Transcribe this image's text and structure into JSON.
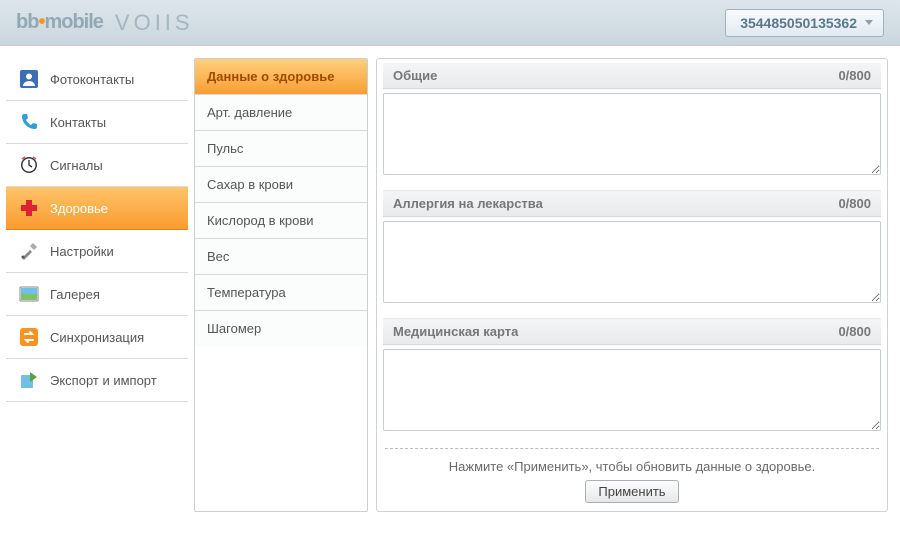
{
  "header": {
    "brand_bb_prefix": "bb",
    "brand_bb_suffix": "mobile",
    "brand_voiis": "VOIIS",
    "device_id": "354485050135362"
  },
  "nav": {
    "items": [
      {
        "label": "Фотоконтакты",
        "icon": "photo-contact"
      },
      {
        "label": "Контакты",
        "icon": "phone"
      },
      {
        "label": "Сигналы",
        "icon": "clock"
      },
      {
        "label": "Здоровье",
        "icon": "plus-medical",
        "active": true
      },
      {
        "label": "Настройки",
        "icon": "tools"
      },
      {
        "label": "Галерея",
        "icon": "gallery"
      },
      {
        "label": "Синхронизация",
        "icon": "sync"
      },
      {
        "label": "Экспорт и импорт",
        "icon": "export"
      }
    ]
  },
  "subnav": {
    "items": [
      {
        "label": "Данные о здоровье",
        "active": true
      },
      {
        "label": "Арт. давление"
      },
      {
        "label": "Пульс"
      },
      {
        "label": "Сахар в крови"
      },
      {
        "label": "Кислород в крови"
      },
      {
        "label": "Вес"
      },
      {
        "label": "Температура"
      },
      {
        "label": "Шагомер"
      }
    ]
  },
  "sections": [
    {
      "title": "Общие",
      "counter": "0/800"
    },
    {
      "title": "Аллергия на лекарства",
      "counter": "0/800"
    },
    {
      "title": "Медицинская карта",
      "counter": "0/800"
    }
  ],
  "footer": {
    "hint": "Нажмите «Применить», чтобы обновить данные о здоровье.",
    "apply_label": "Применить"
  }
}
